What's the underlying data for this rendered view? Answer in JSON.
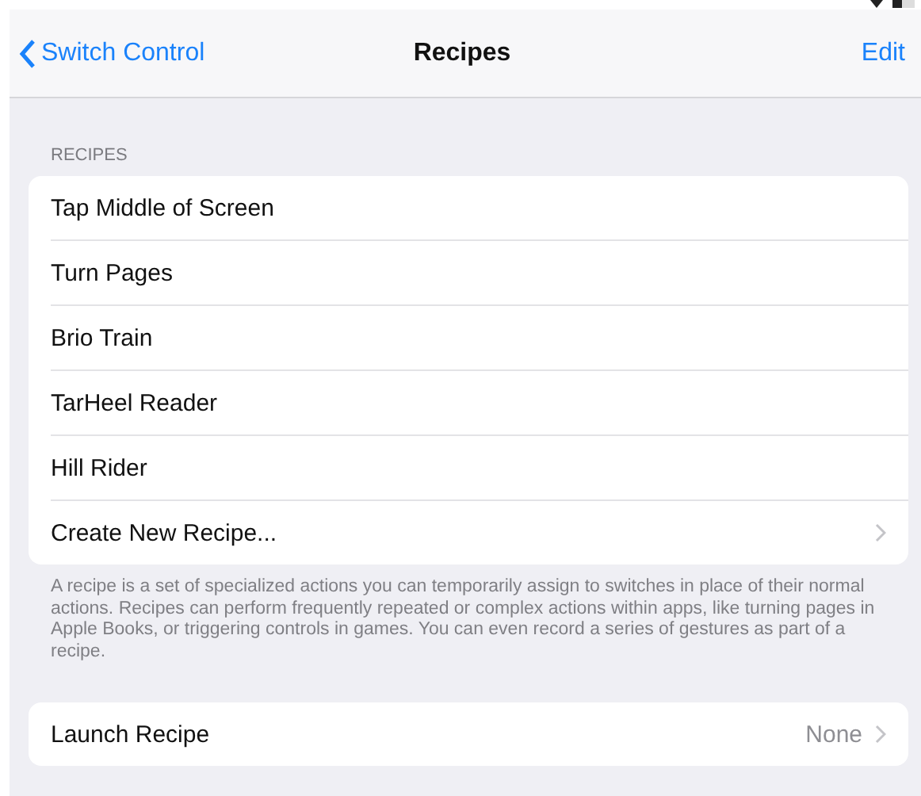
{
  "nav_bar": {
    "back": "Switch Control",
    "title": "Recipes",
    "action": "Edit"
  },
  "recipes_section": {
    "header": "RECIPES",
    "items": [
      {
        "label": "Tap Middle of Screen",
        "kind": "plain"
      },
      {
        "label": "Turn Pages",
        "kind": "plain"
      },
      {
        "label": "Brio Train",
        "kind": "plain"
      },
      {
        "label": "TarHeel Reader",
        "kind": "plain"
      },
      {
        "label": "Hill Rider",
        "kind": "plain"
      },
      {
        "label": "Create New Recipe...",
        "kind": "disclosure"
      }
    ],
    "footer": "A recipe is a set of specialized actions you can temporarily assign to switches in place of their normal actions. Recipes can perform frequently repeated or complex actions within apps, like turning pages in Apple Books, or triggering controls in games. You can even record a series of gestures as part of a recipe."
  },
  "launch_section": {
    "items": [
      {
        "label": "Launch Recipe",
        "kind": "disclosure",
        "value": "None"
      }
    ]
  }
}
